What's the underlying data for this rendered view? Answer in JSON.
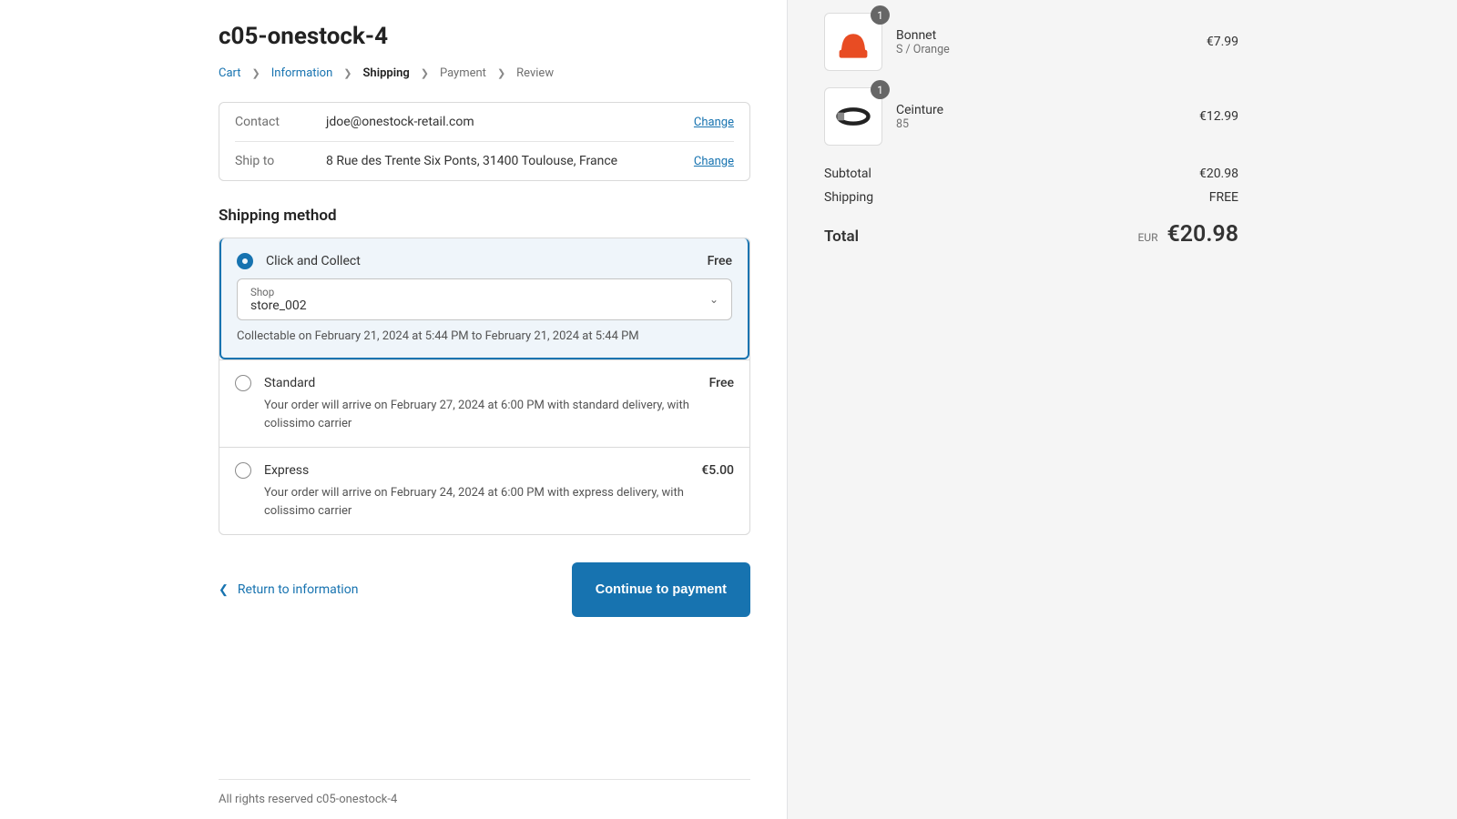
{
  "title": "c05-onestock-4",
  "breadcrumb": {
    "cart": "Cart",
    "information": "Information",
    "shipping": "Shipping",
    "payment": "Payment",
    "review": "Review"
  },
  "review": {
    "contact_label": "Contact",
    "contact_value": "jdoe@onestock-retail.com",
    "shipto_label": "Ship to",
    "shipto_value": "8 Rue des Trente Six Ponts, 31400 Toulouse, France",
    "change_label": "Change"
  },
  "shipping_section_title": "Shipping method",
  "methods": {
    "click_collect": {
      "name": "Click and Collect",
      "price": "Free",
      "shop_label": "Shop",
      "shop_value": "store_002",
      "collect_note": "Collectable on February 21, 2024 at 5:44 PM to February 21, 2024 at 5:44 PM"
    },
    "standard": {
      "name": "Standard",
      "price": "Free",
      "desc": "Your order will arrive on February 27, 2024 at 6:00 PM with standard delivery, with colissimo carrier"
    },
    "express": {
      "name": "Express",
      "price": "€5.00",
      "desc": "Your order will arrive on February 24, 2024 at 6:00 PM with express delivery, with colissimo carrier"
    }
  },
  "actions": {
    "return_label": "Return to information",
    "continue_label": "Continue to payment"
  },
  "footer": "All rights reserved c05-onestock-4",
  "cart": {
    "items": [
      {
        "qty": "1",
        "name": "Bonnet",
        "variant": "S / Orange",
        "price": "€7.99"
      },
      {
        "qty": "1",
        "name": "Ceinture",
        "variant": "85",
        "price": "€12.99"
      }
    ],
    "subtotal_label": "Subtotal",
    "subtotal_value": "€20.98",
    "shipping_label": "Shipping",
    "shipping_value": "FREE",
    "total_label": "Total",
    "total_currency": "EUR",
    "total_value": "€20.98"
  }
}
